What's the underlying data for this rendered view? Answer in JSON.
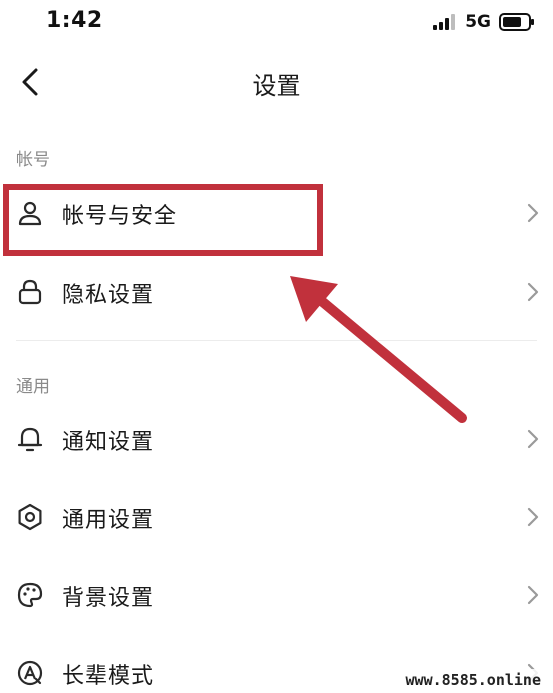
{
  "status_bar": {
    "time": "1:42",
    "network": "5G",
    "icons": [
      "signal-icon",
      "battery-icon"
    ]
  },
  "nav": {
    "title": "设置",
    "back_icon": "chevron-left-icon"
  },
  "sections": [
    {
      "header": "帐号",
      "items": [
        {
          "label": "帐号与安全",
          "icon": "user-icon",
          "highlighted": true
        },
        {
          "label": "隐私设置",
          "icon": "lock-icon"
        }
      ]
    },
    {
      "header": "通用",
      "items": [
        {
          "label": "通知设置",
          "icon": "bell-icon"
        },
        {
          "label": "通用设置",
          "icon": "gear-icon"
        },
        {
          "label": "背景设置",
          "icon": "palette-icon"
        },
        {
          "label": "长辈模式",
          "icon": "elder-mode-icon"
        }
      ]
    }
  ],
  "annotation": {
    "highlight_color": "#c1313c",
    "arrow_color": "#c1313c"
  },
  "watermark": "www.8585.online",
  "colors": {
    "text": "#1a1a1a",
    "section_header": "#8a8a8a",
    "chevron": "#9a9a9a",
    "icon": "#2a2a2a"
  }
}
